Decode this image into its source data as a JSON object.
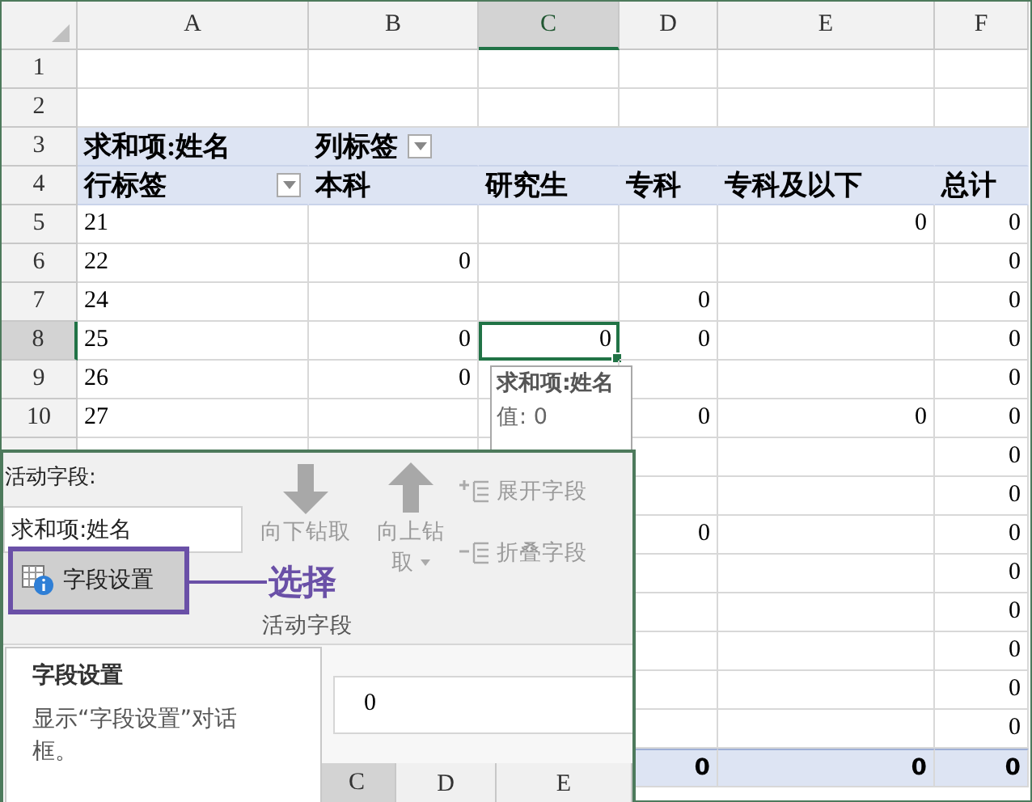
{
  "column_headers": [
    {
      "label": "A",
      "selected": false
    },
    {
      "label": "B",
      "selected": false
    },
    {
      "label": "C",
      "selected": true
    },
    {
      "label": "D",
      "selected": false
    },
    {
      "label": "E",
      "selected": false
    },
    {
      "label": "F",
      "selected": false
    }
  ],
  "rows": [
    {
      "header": "1",
      "selected": false,
      "kind": "data",
      "cells": [
        null,
        null,
        null,
        null,
        null,
        null
      ]
    },
    {
      "header": "2",
      "selected": false,
      "kind": "data",
      "cells": [
        null,
        null,
        null,
        null,
        null,
        null
      ]
    },
    {
      "header": "3",
      "selected": false,
      "kind": "pivot_header",
      "cells": [
        {
          "text": "求和项:姓名",
          "dropdown": false
        },
        {
          "text": "列标签",
          "dropdown": true
        },
        null,
        null,
        null,
        null
      ]
    },
    {
      "header": "4",
      "selected": false,
      "kind": "pivot_header",
      "cells": [
        {
          "text": "行标签",
          "dropdown": true
        },
        {
          "text": "本科",
          "dropdown": false
        },
        {
          "text": "研究生",
          "dropdown": false
        },
        {
          "text": "专科",
          "dropdown": false
        },
        {
          "text": "专科及以下",
          "dropdown": false
        },
        {
          "text": "总计",
          "dropdown": false
        }
      ]
    },
    {
      "header": "5",
      "selected": false,
      "kind": "data",
      "cells": [
        "21",
        null,
        null,
        null,
        "0",
        "0"
      ]
    },
    {
      "header": "6",
      "selected": false,
      "kind": "data",
      "cells": [
        "22",
        "0",
        null,
        null,
        null,
        "0"
      ]
    },
    {
      "header": "7",
      "selected": false,
      "kind": "data",
      "cells": [
        "24",
        null,
        null,
        "0",
        null,
        "0"
      ]
    },
    {
      "header": "8",
      "selected": true,
      "kind": "data",
      "cells": [
        "25",
        "0",
        "0",
        "0",
        null,
        "0"
      ]
    },
    {
      "header": "9",
      "selected": false,
      "kind": "data",
      "cells": [
        "26",
        "0",
        null,
        null,
        null,
        "0"
      ]
    },
    {
      "header": "10",
      "selected": false,
      "kind": "data",
      "cells": [
        "27",
        null,
        null,
        "0",
        "0",
        "0"
      ]
    },
    {
      "kind": "data",
      "cells": [
        null,
        null,
        null,
        null,
        null,
        "0"
      ]
    },
    {
      "kind": "data",
      "cells": [
        null,
        null,
        null,
        null,
        null,
        "0"
      ]
    },
    {
      "kind": "data",
      "cells": [
        null,
        null,
        null,
        "0",
        null,
        "0"
      ]
    },
    {
      "kind": "data",
      "cells": [
        null,
        null,
        null,
        null,
        null,
        "0"
      ]
    },
    {
      "kind": "data",
      "cells": [
        null,
        null,
        null,
        null,
        null,
        "0"
      ]
    },
    {
      "kind": "data",
      "cells": [
        null,
        null,
        null,
        null,
        null,
        "0"
      ]
    },
    {
      "kind": "data",
      "cells": [
        null,
        null,
        null,
        null,
        null,
        "0"
      ]
    },
    {
      "kind": "data",
      "cells": [
        null,
        null,
        null,
        null,
        null,
        "0"
      ]
    },
    {
      "kind": "total",
      "cells": [
        null,
        null,
        null,
        "0",
        "0",
        "0"
      ]
    }
  ],
  "cell_tooltip": {
    "title": "求和项:姓名",
    "value": "值: 0"
  },
  "field_panel": {
    "label": "活动字段:",
    "field_value": "求和项:姓名",
    "settings_button": {
      "label": "字段设置",
      "highlighted": true
    },
    "callout": "选择",
    "drill_buttons": [
      {
        "kind": "down",
        "label": "向下钻取",
        "disabled": true,
        "caret": false
      },
      {
        "kind": "up",
        "label": "向上钻取",
        "disabled": true,
        "caret": true
      }
    ],
    "field_buttons": [
      {
        "kind": "expand",
        "label": "展开字段",
        "disabled": true
      },
      {
        "kind": "collapse",
        "label": "折叠字段",
        "disabled": true
      }
    ],
    "group_label": "活动字段",
    "help_card": {
      "title": "字段设置",
      "description": "显示“字段设置”对话框。"
    },
    "formula_value": "0",
    "column_headers": [
      {
        "label": "C",
        "selected": true
      },
      {
        "label": "D",
        "selected": false
      },
      {
        "label": "E",
        "selected": false
      }
    ]
  }
}
